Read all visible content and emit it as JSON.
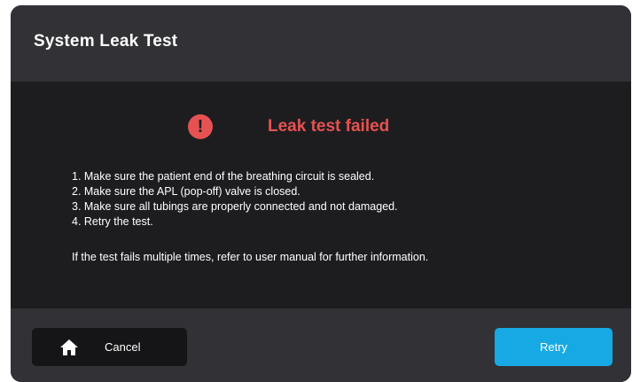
{
  "dialog": {
    "title": "System Leak Test"
  },
  "status": {
    "icon": "alert-circle-icon",
    "glyph": "!",
    "text": "Leak test failed",
    "color": "#e65252"
  },
  "instructions": [
    "1. Make sure the patient end of the breathing circuit is sealed.",
    "2. Make sure the APL (pop-off) valve is closed.",
    "3. Make sure all tubings are properly connected and not damaged.",
    "4. Retry the test."
  ],
  "note": "If the test fails multiple times, refer to user manual for further information.",
  "footer": {
    "cancel_label": "Cancel",
    "cancel_icon": "home-icon",
    "retry_label": "Retry",
    "retry_color": "#16a9e4"
  }
}
